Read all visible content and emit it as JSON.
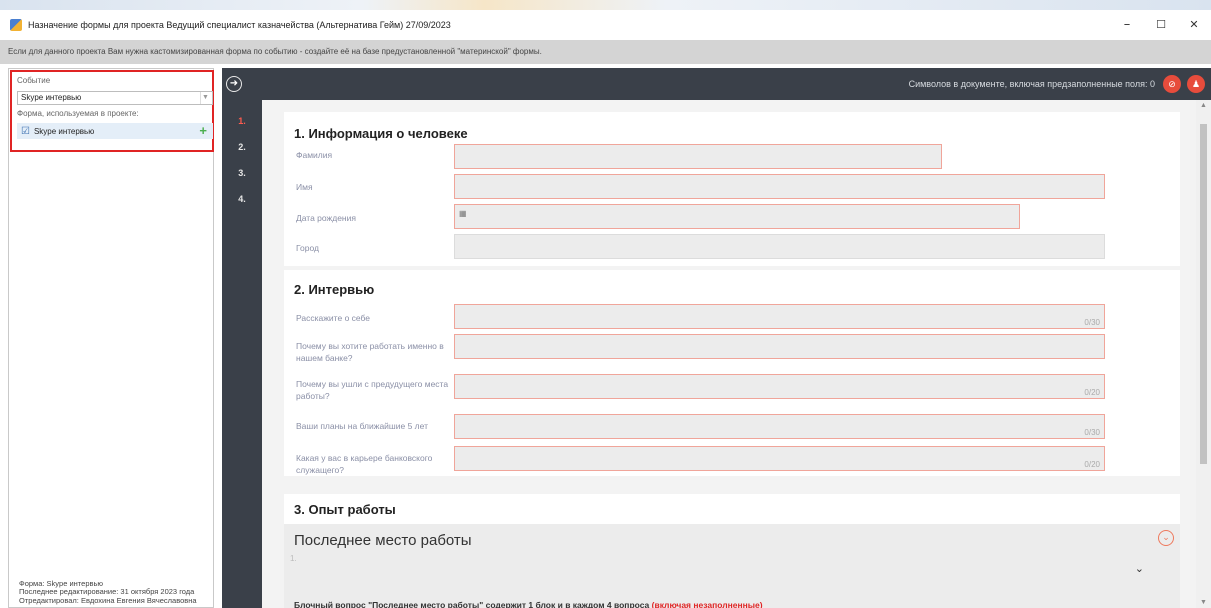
{
  "window": {
    "title": "Назначение формы для проекта Ведущий специалист казначейства (Альтернатива Гейм) 27/09/2023",
    "minimize": "–",
    "maximize": "☐",
    "close": "✕"
  },
  "infobar": {
    "text": "Если для данного проекта Вам нужна кастомизированная форма по событию - создайте её на базе предустановленной \"материнской\" формы."
  },
  "sidebar": {
    "event_label": "Событие",
    "event_value": "Skype интервью",
    "forms_label": "Форма, используемая в проекте:",
    "form_item": "Skype интервью",
    "footer": {
      "form": "Форма: Skype интервью",
      "edited": "Последнее редактирование: 31 октября 2023 года",
      "editor": "Отредактировал: Евдохина Евгения Вячеславовна"
    }
  },
  "header": {
    "counter": "Символов в документе, включая предзаполненные поля: 0"
  },
  "steps": [
    "1.",
    "2.",
    "3.",
    "4."
  ],
  "sections": {
    "s1": {
      "title": "1. Информация о человеке",
      "fields": [
        "Фамилия",
        "Имя",
        "Дата рождения",
        "Город"
      ]
    },
    "s2": {
      "title": "2. Интервью",
      "fields": [
        {
          "label": "Расскажите о себе",
          "counter": "0/30"
        },
        {
          "label": "Почему вы хотите работать именно в нашем банке?",
          "counter": ""
        },
        {
          "label": "Почему вы ушли с предудущего места работы?",
          "counter": "0/20"
        },
        {
          "label": "Ваши планы на ближайшие 5 лет",
          "counter": "0/30"
        },
        {
          "label": "Какая у вас в карьере банковского служащего?",
          "counter": "0/20"
        }
      ]
    },
    "s3": {
      "title": "3. Опыт работы",
      "block_title": "Последнее место работы",
      "block_number": "1.",
      "note": "Блочный вопрос \"Последнее место работы\" содержит 1 блок и в каждом 4 вопроса ",
      "note_red": "(включая незаполненные)"
    }
  },
  "icons": {
    "arrow": "arrow-right-circle-icon",
    "calendar": "calendar-icon",
    "plus": "plus-icon",
    "check": "checkbox-icon"
  },
  "colors": {
    "header_bg": "#3a4049",
    "accent_red": "#e74c3c",
    "field_border": "#f0a59a"
  }
}
